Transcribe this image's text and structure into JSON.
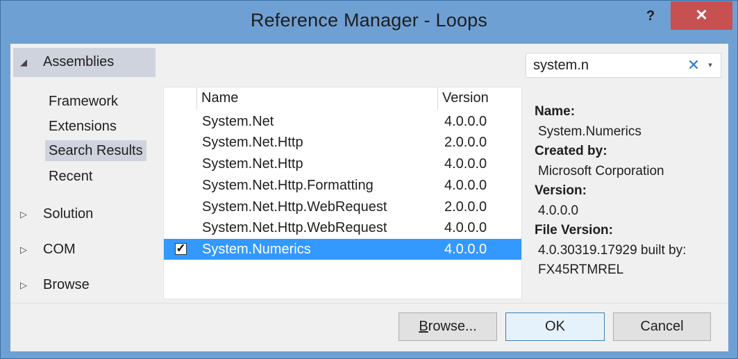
{
  "window": {
    "title": "Reference Manager - Loops",
    "help_label": "?",
    "close_label": "✕"
  },
  "nav": {
    "header": {
      "label": "Assemblies",
      "expander": "◢"
    },
    "sub_items": [
      {
        "label": "Framework"
      },
      {
        "label": "Extensions"
      },
      {
        "label": "Search Results"
      },
      {
        "label": "Recent"
      }
    ],
    "collapsed_groups": [
      {
        "label": "Solution",
        "expander": "▷"
      },
      {
        "label": "COM",
        "expander": "▷"
      },
      {
        "label": "Browse",
        "expander": "▷"
      }
    ]
  },
  "search": {
    "value": "system.n",
    "clear_icon": "✕",
    "dropdown_icon": "▾"
  },
  "list": {
    "columns": {
      "name": "Name",
      "version": "Version"
    },
    "rows": [
      {
        "name": "System.Net",
        "version": "4.0.0.0",
        "checked": false
      },
      {
        "name": "System.Net.Http",
        "version": "2.0.0.0",
        "checked": false
      },
      {
        "name": "System.Net.Http",
        "version": "4.0.0.0",
        "checked": false
      },
      {
        "name": "System.Net.Http.Formatting",
        "version": "4.0.0.0",
        "checked": false
      },
      {
        "name": "System.Net.Http.WebRequest",
        "version": "2.0.0.0",
        "checked": false
      },
      {
        "name": "System.Net.Http.WebRequest",
        "version": "4.0.0.0",
        "checked": false
      },
      {
        "name": "System.Numerics",
        "version": "4.0.0.0",
        "checked": true,
        "selected": true
      }
    ],
    "check_glyph": "✓"
  },
  "details": {
    "name_label": "Name:",
    "name_value": "System.Numerics",
    "created_label": "Created by:",
    "created_value": "Microsoft Corporation",
    "version_label": "Version:",
    "version_value": "4.0.0.0",
    "file_version_label": "File Version:",
    "file_version_value_1": "4.0.30319.17929 built by:",
    "file_version_value_2": "FX45RTMREL"
  },
  "footer": {
    "browse_first": "B",
    "browse_rest": "rowse...",
    "ok": "OK",
    "cancel": "Cancel"
  },
  "colors": {
    "title_bar": "#6fa0d3",
    "close_button": "#c75050",
    "selection": "#3399ff",
    "nav_highlight": "#cfd3de"
  }
}
